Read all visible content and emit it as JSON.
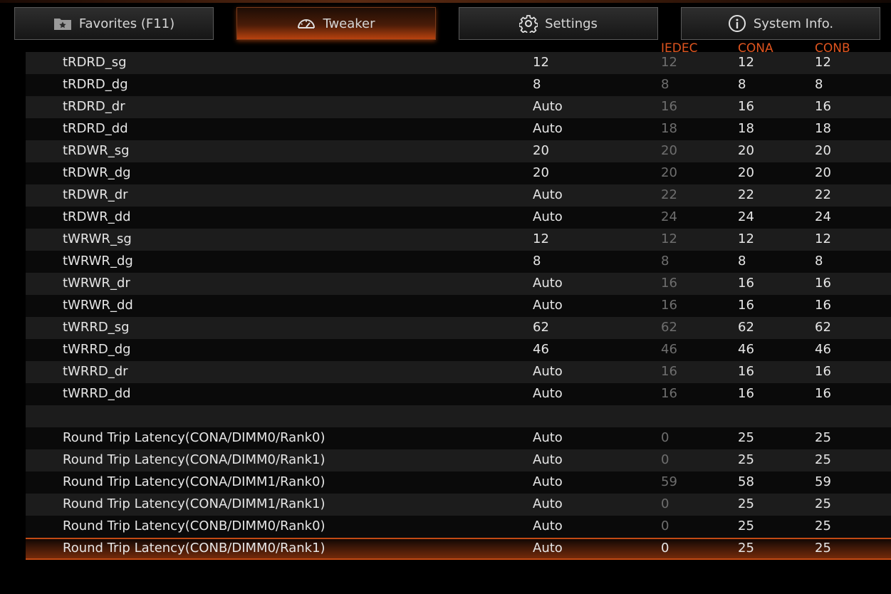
{
  "tabs": [
    {
      "label": "Favorites (F11)",
      "icon": "favorites-folder-icon",
      "active": false
    },
    {
      "label": "Tweaker",
      "icon": "speedometer-icon",
      "active": true
    },
    {
      "label": "Settings",
      "icon": "gear-icon",
      "active": false
    },
    {
      "label": "System Info.",
      "icon": "info-icon",
      "active": false
    }
  ],
  "columns": {
    "jedec": "JEDEC",
    "cona": "CONA",
    "conb": "CONB"
  },
  "colors": {
    "accent": "#e0551f",
    "dim_value": "#6e6e6e"
  },
  "rows": [
    {
      "name": "tRDRD_sg",
      "value": "12",
      "jedec": "12",
      "cona": "12",
      "conb": "12"
    },
    {
      "name": "tRDRD_dg",
      "value": "8",
      "jedec": "8",
      "cona": "8",
      "conb": "8"
    },
    {
      "name": "tRDRD_dr",
      "value": "Auto",
      "jedec": "16",
      "cona": "16",
      "conb": "16"
    },
    {
      "name": "tRDRD_dd",
      "value": "Auto",
      "jedec": "18",
      "cona": "18",
      "conb": "18"
    },
    {
      "name": "tRDWR_sg",
      "value": "20",
      "jedec": "20",
      "cona": "20",
      "conb": "20"
    },
    {
      "name": "tRDWR_dg",
      "value": "20",
      "jedec": "20",
      "cona": "20",
      "conb": "20"
    },
    {
      "name": "tRDWR_dr",
      "value": "Auto",
      "jedec": "22",
      "cona": "22",
      "conb": "22"
    },
    {
      "name": "tRDWR_dd",
      "value": "Auto",
      "jedec": "24",
      "cona": "24",
      "conb": "24"
    },
    {
      "name": "tWRWR_sg",
      "value": "12",
      "jedec": "12",
      "cona": "12",
      "conb": "12"
    },
    {
      "name": "tWRWR_dg",
      "value": "8",
      "jedec": "8",
      "cona": "8",
      "conb": "8"
    },
    {
      "name": "tWRWR_dr",
      "value": "Auto",
      "jedec": "16",
      "cona": "16",
      "conb": "16"
    },
    {
      "name": "tWRWR_dd",
      "value": "Auto",
      "jedec": "16",
      "cona": "16",
      "conb": "16"
    },
    {
      "name": "tWRRD_sg",
      "value": "62",
      "jedec": "62",
      "cona": "62",
      "conb": "62"
    },
    {
      "name": "tWRRD_dg",
      "value": "46",
      "jedec": "46",
      "cona": "46",
      "conb": "46"
    },
    {
      "name": "tWRRD_dr",
      "value": "Auto",
      "jedec": "16",
      "cona": "16",
      "conb": "16"
    },
    {
      "name": "tWRRD_dd",
      "value": "Auto",
      "jedec": "16",
      "cona": "16",
      "conb": "16"
    },
    {
      "name": "",
      "value": "",
      "jedec": "",
      "cona": "",
      "conb": ""
    },
    {
      "name": "Round Trip Latency(CONA/DIMM0/Rank0)",
      "value": "Auto",
      "jedec": "0",
      "cona": "25",
      "conb": "25"
    },
    {
      "name": "Round Trip Latency(CONA/DIMM0/Rank1)",
      "value": "Auto",
      "jedec": "0",
      "cona": "25",
      "conb": "25"
    },
    {
      "name": "Round Trip Latency(CONA/DIMM1/Rank0)",
      "value": "Auto",
      "jedec": "59",
      "cona": "58",
      "conb": "59"
    },
    {
      "name": "Round Trip Latency(CONA/DIMM1/Rank1)",
      "value": "Auto",
      "jedec": "0",
      "cona": "25",
      "conb": "25"
    },
    {
      "name": "Round Trip Latency(CONB/DIMM0/Rank0)",
      "value": "Auto",
      "jedec": "0",
      "cona": "25",
      "conb": "25"
    },
    {
      "name": "Round Trip Latency(CONB/DIMM0/Rank1)",
      "value": "Auto",
      "jedec": "0",
      "cona": "25",
      "conb": "25",
      "selected": true
    }
  ]
}
